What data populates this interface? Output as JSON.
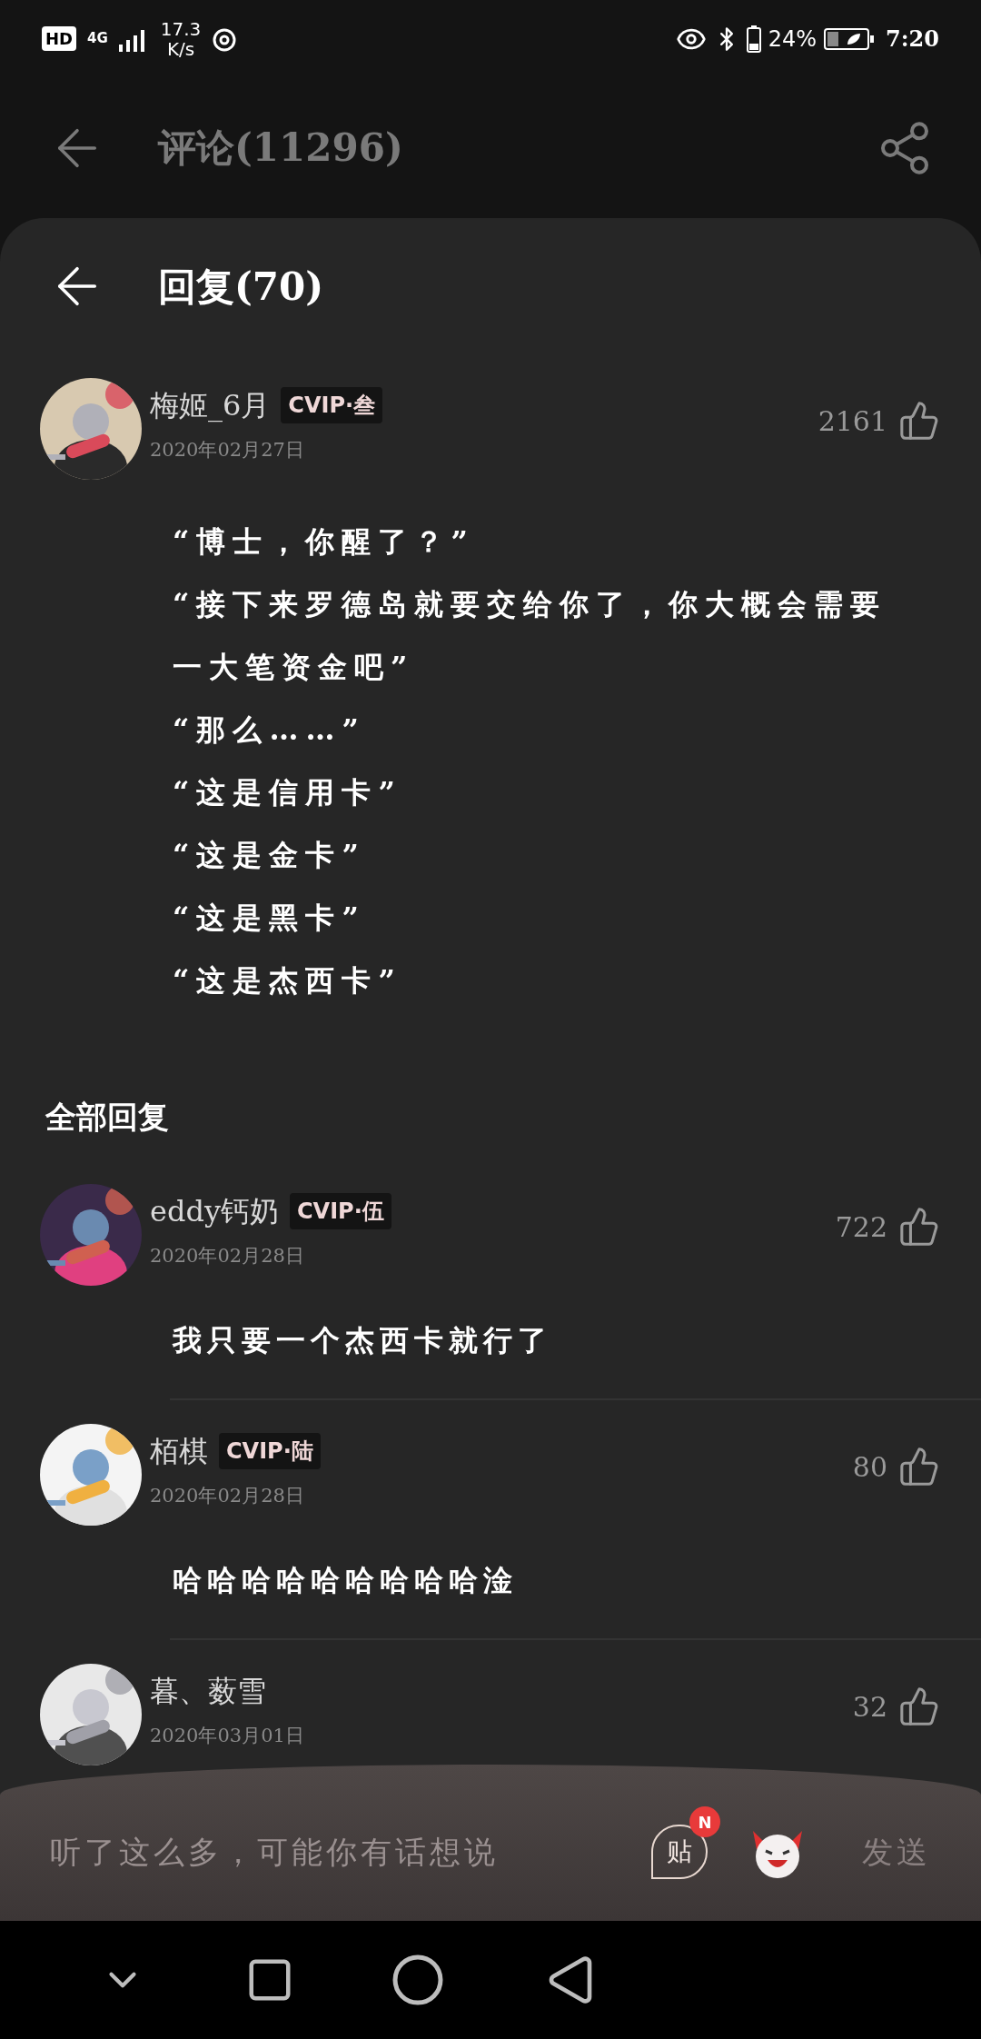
{
  "status_bar": {
    "hd": "HD",
    "network": "4G",
    "speed": "17.3",
    "speed_unit": "K/s",
    "battery": "24%",
    "time": "7:20"
  },
  "header": {
    "title": "评论(11296)"
  },
  "reply_sheet": {
    "title": "回复(70)"
  },
  "main_comment": {
    "user": "梅姬_6月",
    "badge": "CVIP·叁",
    "date": "2020年02月27日",
    "likes": "2161",
    "lines": [
      "“博士，你醒了？”",
      "“接下来罗德岛就要交给你了，你大概会需要一大笔资金吧”",
      "“那么……”",
      "“这是信用卡”",
      "“这是金卡”",
      "“这是黑卡”",
      "“这是杰西卡”"
    ]
  },
  "section_title": "全部回复",
  "replies": [
    {
      "user": "eddy钙奶",
      "badge": "CVIP·伍",
      "date": "2020年02月28日",
      "likes": "722",
      "text": "我只要一个杰西卡就行了"
    },
    {
      "user": "栢棋",
      "badge": "CVIP·陆",
      "date": "2020年02月28日",
      "likes": "80",
      "text": "哈哈哈哈哈哈哈哈哈淦"
    },
    {
      "user": "暮、薮雪",
      "date": "2020年03月01日",
      "likes": "32"
    }
  ],
  "input_bar": {
    "placeholder": "听了这么多，可能你有话想说",
    "sticker_label": "贴",
    "sticker_badge": "N",
    "send": "发送"
  }
}
